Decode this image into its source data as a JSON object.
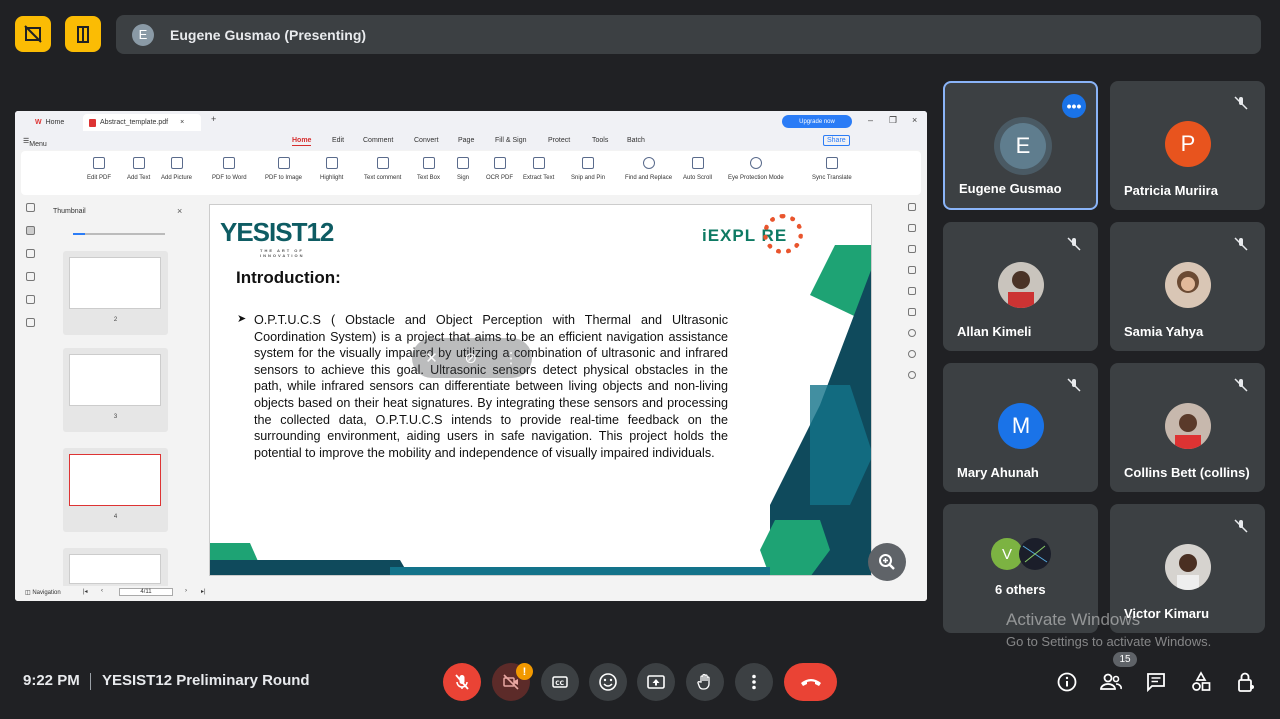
{
  "top": {
    "presenter_initial": "E",
    "presenter_text": "Eugene Gusmao (Presenting)"
  },
  "pdf": {
    "tab_home": "Home",
    "tab_file": "Abstract_template.pdf",
    "upgrade": "Upgrade now",
    "menu_label": "Menu",
    "menu": [
      "Home",
      "Edit",
      "Comment",
      "Convert",
      "Page",
      "Fill & Sign",
      "Protect",
      "Tools",
      "Batch"
    ],
    "share": "Share",
    "tools": [
      "Edit PDF",
      "Add Text",
      "Add Picture",
      "PDF to Word",
      "PDF to Image",
      "Highlight",
      "Text comment",
      "Text Box",
      "Sign",
      "OCR PDF",
      "Extract Text",
      "Snip and Pin",
      "Find and Replace",
      "Auto Scroll",
      "Eye Protection Mode",
      "Sync Translate"
    ],
    "thumbnail_title": "Thumbnail",
    "thumb_pages": [
      "2",
      "3",
      "4"
    ],
    "navigation": "Navigation",
    "page_indicator": "4/11"
  },
  "slide": {
    "logo_left": "YESIST12",
    "logo_left_tag": "THE ART OF INNOVATION",
    "logo_right": "iEXPL  RE",
    "title": "Introduction:",
    "body": "O.P.T.U.C.S ( Obstacle and Object Perception with Thermal and Ultrasonic Coordination System) is a project that aims to be an efficient navigation assistance system for the visually impaired by utilizing a combination of ultrasonic and infrared sensors to achieve this goal. Ultrasonic sensors detect physical obstacles in the path, while infrared sensors can differentiate between living objects and non-living objects based on their heat signatures. By integrating these sensors and processing the collected data, O.P.T.U.C.S intends to provide real-time feedback on the surrounding environment, aiding users in safe navigation. This project holds the potential to improve the mobility and independence of visually impaired individuals."
  },
  "participants": [
    {
      "name": "Eugene Gusmao",
      "initial": "E",
      "color": "#5f7d8e",
      "muted": false
    },
    {
      "name": "Patricia Muriira",
      "initial": "P",
      "color": "#e8541e",
      "muted": true
    },
    {
      "name": "Allan Kimeli",
      "initial": "",
      "color": "#c9c4bd",
      "muted": true
    },
    {
      "name": "Samia Yahya",
      "initial": "",
      "color": "#d9c6b5",
      "muted": true
    },
    {
      "name": "Mary Ahunah",
      "initial": "M",
      "color": "#1a73e8",
      "muted": true
    },
    {
      "name": "Collins Bett (collins)",
      "initial": "",
      "color": "#c7b8ad",
      "muted": true
    },
    {
      "name": "6 others",
      "initial": "V",
      "color": "#7cb342",
      "muted": false
    },
    {
      "name": "Victor Kimaru",
      "initial": "",
      "color": "#d6d3cf",
      "muted": true
    }
  ],
  "watermark": {
    "line1": "Activate Windows",
    "line2": "Go to Settings to activate Windows."
  },
  "bottom": {
    "time": "9:22 PM",
    "meeting": "YESIST12 Preliminary Round",
    "people_count": "15",
    "warning": "!"
  },
  "colors": {
    "accent_yellow": "#fbbc04",
    "hangup_red": "#ea4335",
    "bg": "#202124",
    "tile": "#3c4043"
  }
}
